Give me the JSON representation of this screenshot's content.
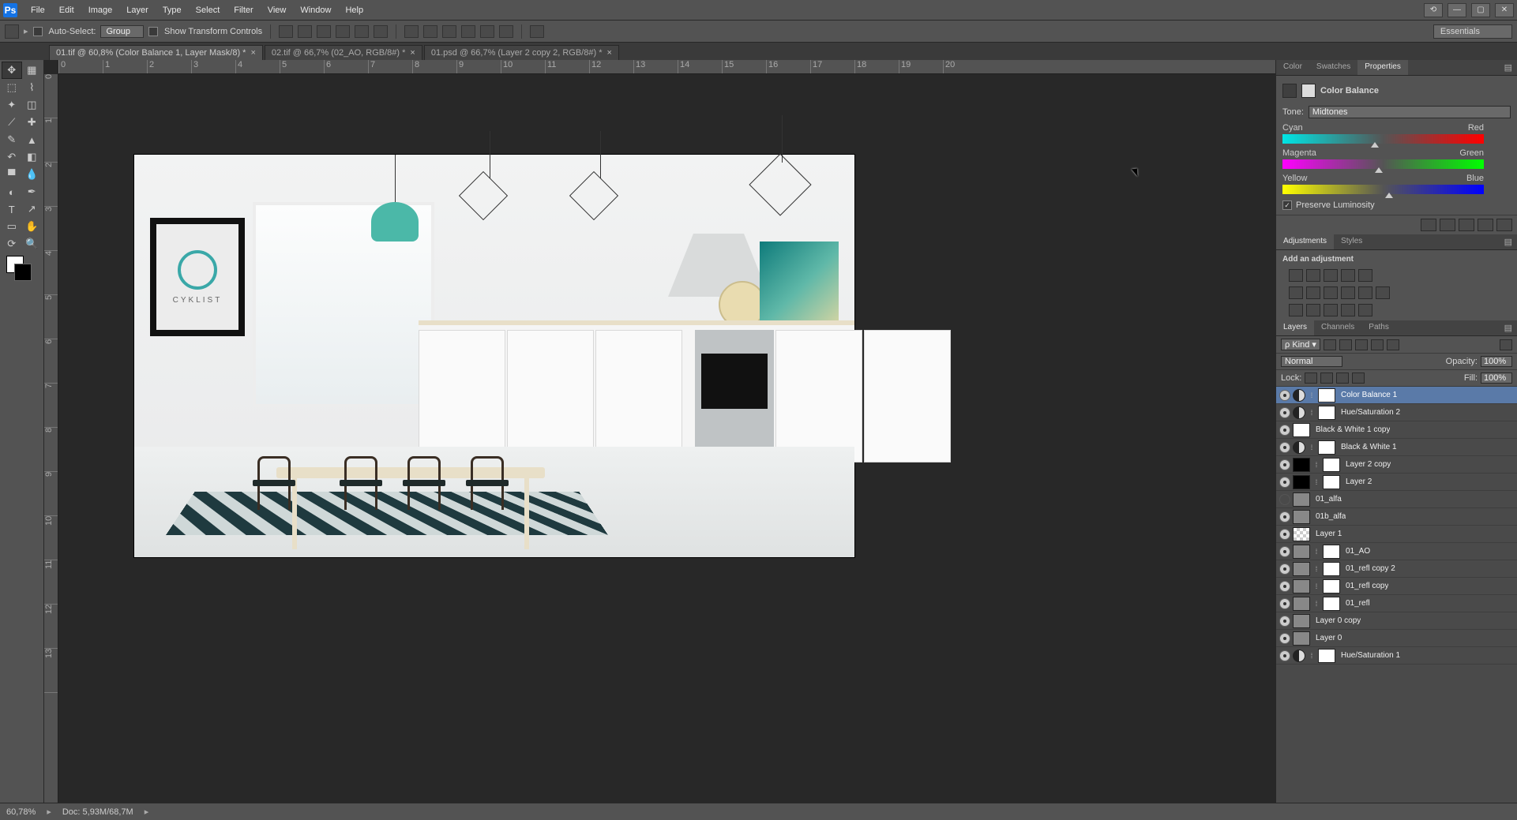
{
  "menu": [
    "File",
    "Edit",
    "Image",
    "Layer",
    "Type",
    "Select",
    "Filter",
    "View",
    "Window",
    "Help"
  ],
  "options": {
    "autoSelect": "Auto-Select:",
    "group": "Group",
    "showTransform": "Show Transform Controls",
    "workspace": "Essentials"
  },
  "tabs": [
    {
      "label": "01.tif @ 60,8% (Color Balance 1, Layer Mask/8) *",
      "active": true
    },
    {
      "label": "02.tif @ 66,7% (02_AO, RGB/8#) *",
      "active": false
    },
    {
      "label": "01.psd @ 66,7% (Layer 2 copy 2, RGB/8#) *",
      "active": false
    }
  ],
  "rulerH": [
    "0",
    "1",
    "2",
    "3",
    "4",
    "5",
    "6",
    "7",
    "8",
    "9",
    "10",
    "11",
    "12",
    "13",
    "14",
    "15",
    "16",
    "17",
    "18",
    "19",
    "20"
  ],
  "rulerV": [
    "0",
    "1",
    "2",
    "3",
    "4",
    "5",
    "6",
    "7",
    "8",
    "9",
    "10",
    "11",
    "12",
    "13"
  ],
  "poster": "CYKLIST",
  "rightTabs": {
    "group1": [
      "Color",
      "Swatches",
      "Properties"
    ],
    "active1": 2,
    "group2": [
      "Adjustments",
      "Styles"
    ],
    "active2": 0,
    "group3": [
      "Layers",
      "Channels",
      "Paths"
    ],
    "active3": 0
  },
  "properties": {
    "title": "Color Balance",
    "toneLabel": "Tone:",
    "toneValue": "Midtones",
    "sliders": [
      {
        "left": "Cyan",
        "right": "Red",
        "val": "-9",
        "pos": 46
      },
      {
        "left": "Magenta",
        "right": "Green",
        "val": "-4",
        "pos": 48
      },
      {
        "left": "Yellow",
        "right": "Blue",
        "val": "+6",
        "pos": 53
      }
    ],
    "preserve": "Preserve Luminosity"
  },
  "adjustments": {
    "title": "Add an adjustment"
  },
  "layersPanel": {
    "kind": "Kind",
    "blend": "Normal",
    "opacityL": "Opacity:",
    "opacity": "100%",
    "lockL": "Lock:",
    "fillL": "Fill:",
    "fill": "100%"
  },
  "layers": [
    {
      "vis": true,
      "adj": true,
      "mask": "white",
      "name": "Color Balance 1",
      "sel": true
    },
    {
      "vis": true,
      "adj": true,
      "mask": "white",
      "name": "Hue/Saturation 2"
    },
    {
      "vis": true,
      "thumb": "white",
      "name": "Black & White 1 copy"
    },
    {
      "vis": true,
      "adj": true,
      "mask": "white",
      "name": "Black & White 1"
    },
    {
      "vis": true,
      "thumb": "black",
      "mask": "white",
      "name": "Layer 2 copy"
    },
    {
      "vis": true,
      "thumb": "black",
      "mask": "white",
      "name": "Layer 2"
    },
    {
      "vis": false,
      "thumb": "img",
      "name": "01_alfa"
    },
    {
      "vis": true,
      "thumb": "img",
      "name": "01b_alfa"
    },
    {
      "vis": true,
      "thumb": "chk",
      "name": "Layer 1"
    },
    {
      "vis": true,
      "thumb": "img",
      "mask": "white",
      "name": "01_AO"
    },
    {
      "vis": true,
      "thumb": "img",
      "mask": "white",
      "name": "01_refl copy 2"
    },
    {
      "vis": true,
      "thumb": "img",
      "mask": "white",
      "name": "01_refl copy"
    },
    {
      "vis": true,
      "thumb": "img",
      "mask": "white",
      "name": "01_refl"
    },
    {
      "vis": true,
      "thumb": "img",
      "name": "Layer 0 copy"
    },
    {
      "vis": true,
      "thumb": "img",
      "name": "Layer 0"
    },
    {
      "vis": true,
      "adj": true,
      "mask": "white",
      "name": "Hue/Saturation 1"
    }
  ],
  "status": {
    "zoom": "60,78%",
    "doc": "Doc: 5,93M/68,7M"
  }
}
